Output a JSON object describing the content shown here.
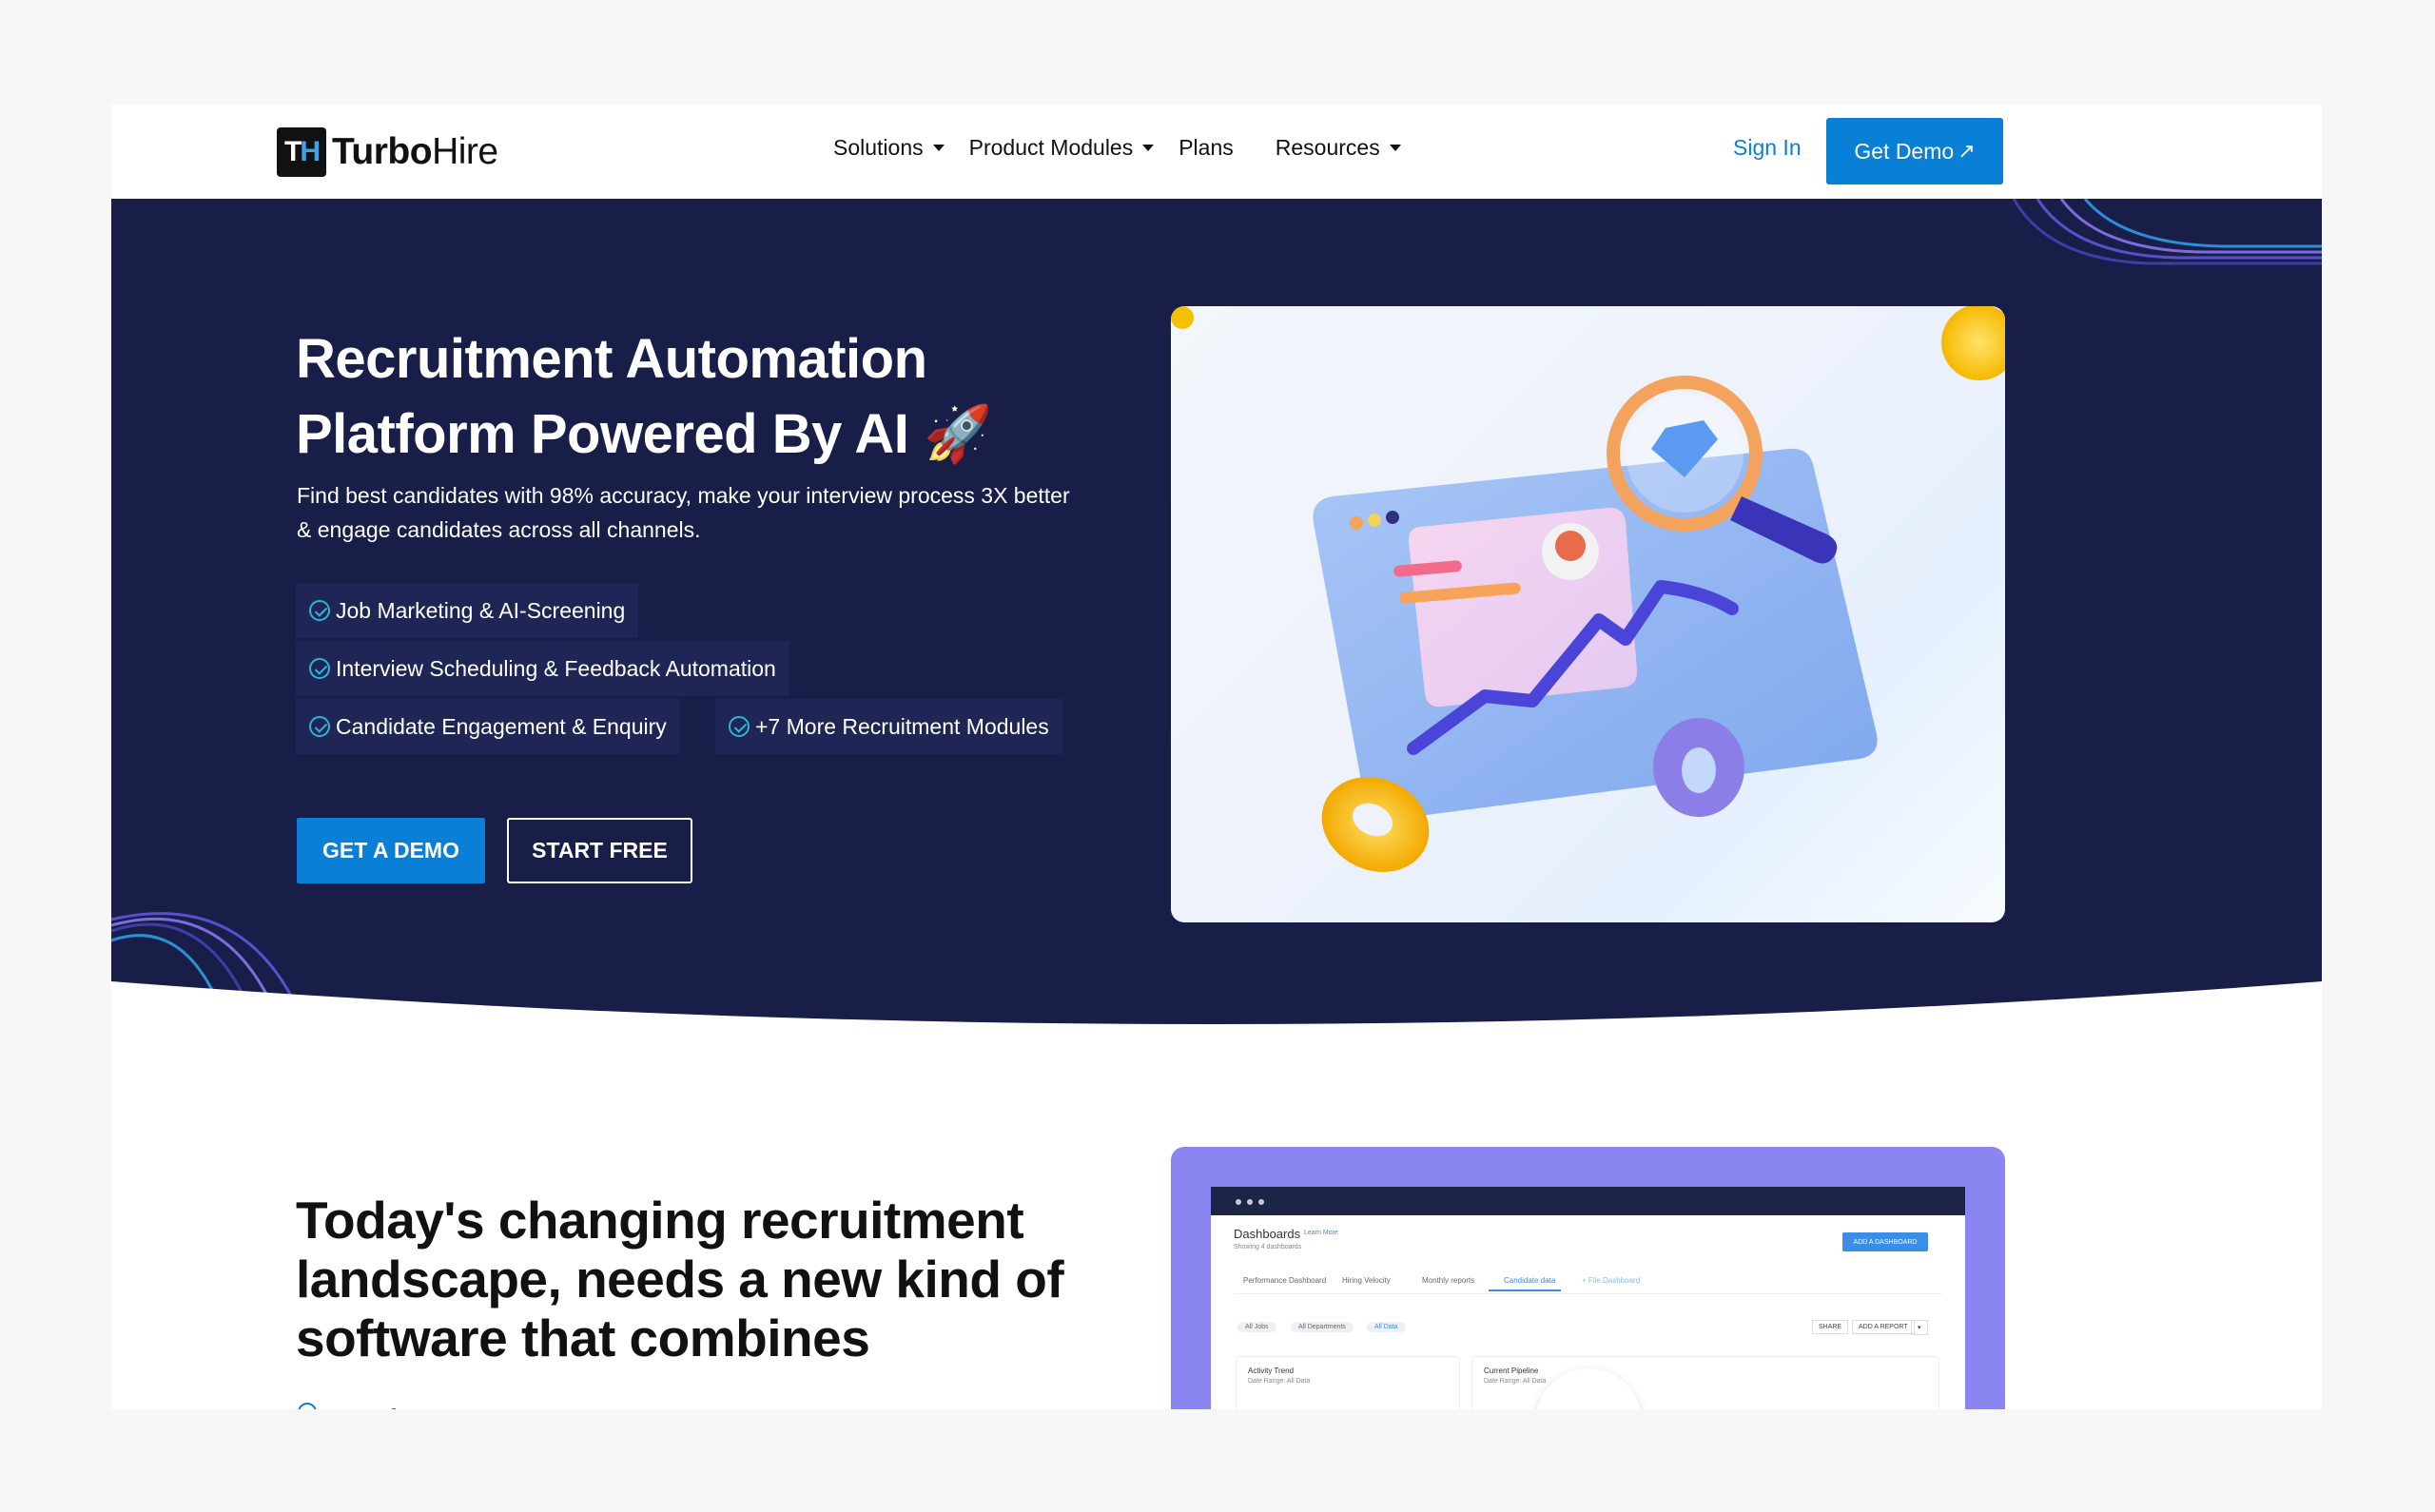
{
  "brand": {
    "mark_t": "T",
    "mark_h": "H",
    "name_bold": "Turbo",
    "name_light": "Hire"
  },
  "nav": {
    "items": [
      {
        "label": "Solutions",
        "has_caret": true
      },
      {
        "label": "Product Modules",
        "has_caret": true
      },
      {
        "label": "Plans",
        "has_caret": false
      },
      {
        "label": "Resources",
        "has_caret": true
      }
    ],
    "sign_in": "Sign In",
    "get_demo": "Get Demo",
    "get_demo_icon": "arrow-up-right-icon"
  },
  "hero": {
    "title_line1": "Recruitment Automation",
    "title_line2": "Platform Powered By AI",
    "title_emoji": "🚀",
    "subtitle": "Find best candidates with 98% accuracy, make your interview process 3X better & engage candidates across all channels.",
    "features": [
      "Job Marketing & AI-Screening",
      "Interview Scheduling & Feedback Automation",
      "Candidate Engagement & Enquiry",
      "+7 More Recruitment Modules"
    ],
    "cta_demo": "GET A DEMO",
    "cta_free": "START FREE"
  },
  "section2": {
    "title": "Today's changing recruitment landscape, needs a new kind of software that combines"
  },
  "dashboard_preview": {
    "title": "Dashboards",
    "learn_more": "Learn More",
    "subtitle": "Showing 4 dashboards",
    "add_button": "ADD A DASHBOARD",
    "tabs": [
      "Performance Dashboard",
      "Hiring Velocity",
      "Monthly reports",
      "Candidate data",
      "+ File Dashboard"
    ],
    "filters": [
      "All Jobs",
      "All Departments",
      "All Data"
    ],
    "actions": [
      "SHARE",
      "ADD A REPORT"
    ],
    "cards": [
      {
        "title": "Activity Trend",
        "sub": "Date Range: All Data"
      },
      {
        "title": "Current Pipeline",
        "sub": "Date Range: All Data"
      }
    ]
  },
  "colors": {
    "accent": "#0a7fd6",
    "hero_bg": "#181e48",
    "feature_bg": "#1f2656",
    "check": "#2bb6d6",
    "dash_frame": "#8a85f0"
  }
}
